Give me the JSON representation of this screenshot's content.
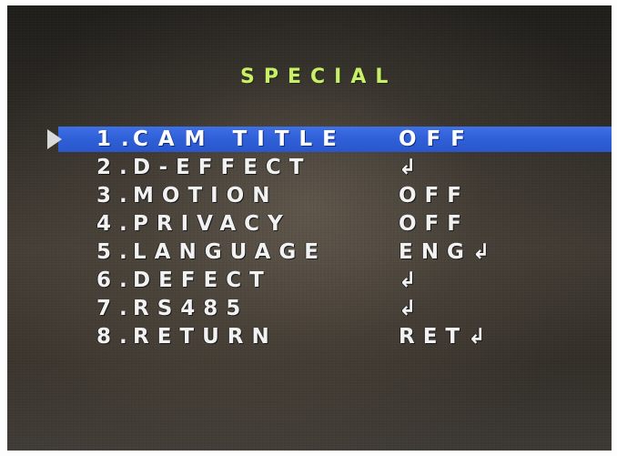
{
  "menu": {
    "title": "SPECIAL",
    "items": [
      {
        "num": "1.",
        "label": "CAM TITLE",
        "value": "OFF",
        "selected": true
      },
      {
        "num": "2.",
        "label": "D-EFFECT",
        "value": "↲",
        "selected": false
      },
      {
        "num": "3.",
        "label": "MOTION",
        "value": "OFF",
        "selected": false
      },
      {
        "num": "4.",
        "label": "PRIVACY",
        "value": "OFF",
        "selected": false
      },
      {
        "num": "5.",
        "label": "LANGUAGE",
        "value": "ENG↲",
        "selected": false
      },
      {
        "num": "6.",
        "label": "DEFECT",
        "value": "↲",
        "selected": false
      },
      {
        "num": "7.",
        "label": "RS485",
        "value": "↲",
        "selected": false
      },
      {
        "num": "8.",
        "label": "RETURN",
        "value": "RET↲",
        "selected": false
      }
    ]
  },
  "colors": {
    "title": "#c8ee6a",
    "highlight": "#2f5fd7",
    "text": "#f2f2f2",
    "cursor": "#d9d9d9"
  }
}
